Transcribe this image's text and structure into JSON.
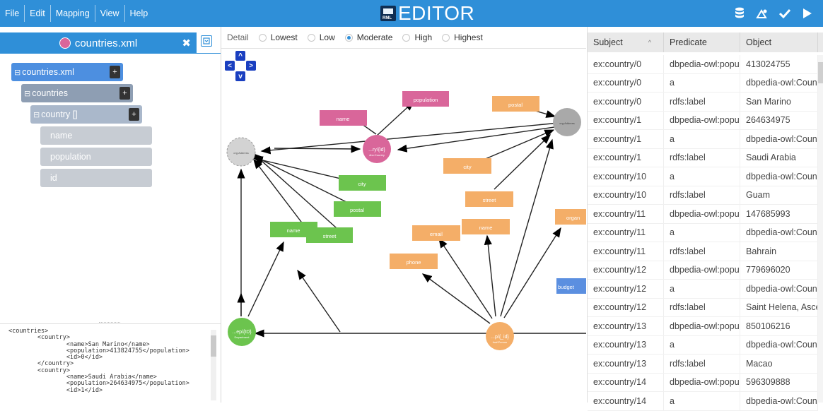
{
  "menu": {
    "file": "File",
    "edit": "Edit",
    "mapping": "Mapping",
    "view": "View",
    "help": "Help"
  },
  "brand": {
    "logo_text": "RML",
    "title": "EDITOR"
  },
  "top_icons": [
    "database-icon",
    "share-icon",
    "check-icon",
    "play-icon"
  ],
  "colors": {
    "topbar": "#2f8fd8",
    "pink": "#d9669a",
    "green": "#6cc44e",
    "orange": "#f4ae68",
    "gray_node": "#a9a9a9",
    "blue": "#5b8fe0"
  },
  "left_panel": {
    "file_tab": "countries.xml",
    "tree": [
      {
        "label": "countries.xml",
        "plus": "+"
      },
      {
        "label": "countries",
        "plus": "+"
      },
      {
        "label": "country []",
        "plus": "+"
      }
    ],
    "leaves": [
      "name",
      "population",
      "id"
    ],
    "code": [
      "<countries>",
      "        <country>",
      "                <name>San Marino</name>",
      "                <population>413824755</population>",
      "                <id>0</id>",
      "        </country>",
      "        <country>",
      "                <name>Saudi Arabia</name>",
      "                <population>264634975</population>",
      "                <id>1</id>"
    ]
  },
  "detail": {
    "label": "Detail",
    "options": [
      "Lowest",
      "Low",
      "Moderate",
      "High",
      "Highest"
    ],
    "selected": "Moderate"
  },
  "nav": {
    "up": "^",
    "left": "<",
    "right": ">",
    "down": "v"
  },
  "graph": {
    "circles": {
      "c_left": "org:Address",
      "c_center": "...ry/{id}",
      "c_center_sub": "dbo:Country",
      "c_topright": "org:Address",
      "c_bottomleft": "...ep/{ID}",
      "c_bottomleft_sub": "Department",
      "c_bottomright": "...p/{_id}",
      "c_bottomright_sub": "foaf:Person"
    },
    "boxes": {
      "name_pink": "name",
      "population_pink": "population",
      "postal_orange": "postal",
      "city_orange": "city",
      "city_green": "city",
      "postal_green": "postal",
      "name_green": "name",
      "street_green": "street",
      "street_orange": "street",
      "email_orange": "email",
      "name_orange": "name",
      "phone_orange": "phone",
      "organization_orange": "organ",
      "budget_blue": "budget"
    }
  },
  "table": {
    "headers": [
      "Subject",
      "Predicate",
      "Object"
    ],
    "sort_icon": "^",
    "rows": [
      [
        "ex:country/0",
        "dbpedia-owl:popula",
        "413024755"
      ],
      [
        "ex:country/0",
        "a",
        "dbpedia-owl:Countr"
      ],
      [
        "ex:country/0",
        "rdfs:label",
        "San Marino"
      ],
      [
        "ex:country/1",
        "dbpedia-owl:popula",
        "264634975"
      ],
      [
        "ex:country/1",
        "a",
        "dbpedia-owl:Countr"
      ],
      [
        "ex:country/1",
        "rdfs:label",
        "Saudi Arabia"
      ],
      [
        "ex:country/10",
        "a",
        "dbpedia-owl:Countr"
      ],
      [
        "ex:country/10",
        "rdfs:label",
        "Guam"
      ],
      [
        "ex:country/11",
        "dbpedia-owl:popula",
        "147685993"
      ],
      [
        "ex:country/11",
        "a",
        "dbpedia-owl:Countr"
      ],
      [
        "ex:country/11",
        "rdfs:label",
        "Bahrain"
      ],
      [
        "ex:country/12",
        "dbpedia-owl:popula",
        "779696020"
      ],
      [
        "ex:country/12",
        "a",
        "dbpedia-owl:Countr"
      ],
      [
        "ex:country/12",
        "rdfs:label",
        "Saint Helena, Ascer"
      ],
      [
        "ex:country/13",
        "dbpedia-owl:popula",
        "850106216"
      ],
      [
        "ex:country/13",
        "a",
        "dbpedia-owl:Countr"
      ],
      [
        "ex:country/13",
        "rdfs:label",
        "Macao"
      ],
      [
        "ex:country/14",
        "dbpedia-owl:popula",
        "596309888"
      ],
      [
        "ex:country/14",
        "a",
        "dbpedia-owl:Countr"
      ]
    ]
  }
}
